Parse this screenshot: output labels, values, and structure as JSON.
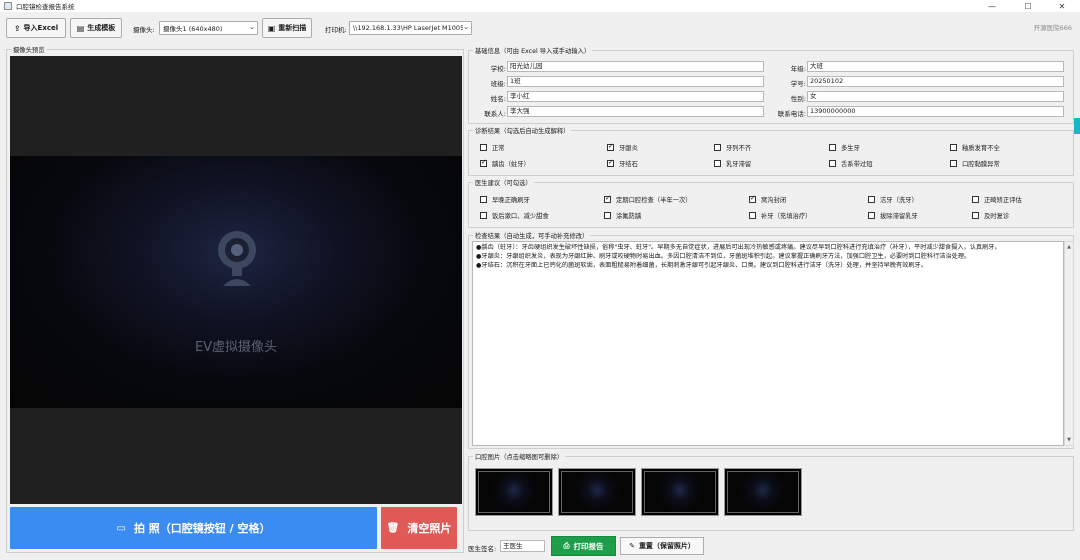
{
  "window": {
    "title": "口腔镜检查报告系统",
    "controls": {
      "minimize": "—",
      "maximize": "☐",
      "close": "✕"
    }
  },
  "toolbar": {
    "import_excel": "导入Excel",
    "generate_template": "生成模板",
    "camera_label": "摄像头:",
    "camera_value": "摄像头1 (640x480)",
    "rescan": "重新扫描",
    "printer_label": "打印机:",
    "printer_value": "\\\\192.168.1.33\\HP LaserJet M1005",
    "brand": "开源医院666"
  },
  "camera_preview": {
    "title": "摄像头预览",
    "device_label": "EV虚拟摄像头"
  },
  "capture": {
    "capture_button": "拍 照（口腔镜按钮 / 空格）",
    "clear_button": "清空照片"
  },
  "basic_info": {
    "title": "基础信息（可由 Excel 导入或手动输入）",
    "school_label": "学校:",
    "school": "阳光幼儿园",
    "grade_label": "年级:",
    "grade": "大班",
    "class_label": "班级:",
    "class": "1班",
    "student_id_label": "学号:",
    "student_id": "20250102",
    "name_label": "姓名:",
    "name": "李小红",
    "gender_label": "性别:",
    "gender": "女",
    "contact_label": "联系人:",
    "contact": "李大强",
    "phone_label": "联系电话:",
    "phone": "13900000000"
  },
  "diagnosis": {
    "title": "诊断结果（勾选后自动生成解释）",
    "items": [
      {
        "label": "正常",
        "checked": false
      },
      {
        "label": "牙龈炎",
        "checked": true
      },
      {
        "label": "牙列不齐",
        "checked": false
      },
      {
        "label": "多生牙",
        "checked": false
      },
      {
        "label": "釉质发育不全",
        "checked": false
      },
      {
        "label": "龋齿（蛀牙）",
        "checked": true
      },
      {
        "label": "牙结石",
        "checked": true
      },
      {
        "label": "乳牙滞留",
        "checked": false
      },
      {
        "label": "舌系带过短",
        "checked": false
      },
      {
        "label": "口腔黏膜异常",
        "checked": false
      }
    ]
  },
  "advice": {
    "title": "医生建议（可勾选）",
    "items": [
      {
        "label": "早晚正确刷牙",
        "checked": false
      },
      {
        "label": "定期口腔检查（半年一次）",
        "checked": true
      },
      {
        "label": "窝沟封闭",
        "checked": true
      },
      {
        "label": "洁牙（洗牙）",
        "checked": false
      },
      {
        "label": "正畸矫正评估",
        "checked": false
      },
      {
        "label": "饭后漱口、减少甜食",
        "checked": false
      },
      {
        "label": "涂氟防龋",
        "checked": false
      },
      {
        "label": "补牙（充填治疗）",
        "checked": false
      },
      {
        "label": "拔除滞留乳牙",
        "checked": false
      },
      {
        "label": "及时复诊",
        "checked": false
      }
    ]
  },
  "results": {
    "title": "检查结果（自动生成，可手动补充修改）",
    "lines": [
      "●龋齿（蛀牙）：牙齿硬组织发生破坏性缺损，俗称\"虫牙、蛀牙\"。早期多无自觉症状，进展后可出现冷热敏感或疼痛。建议尽早到口腔科进行充填治疗（补牙），平时减少甜食摄入，认真刷牙。",
      "●牙龈炎：牙龈组织发炎，表现为牙龈红肿、刷牙或咬硬物时易出血。多因口腔清洁不到位，牙菌斑堆积引起。建议掌握正确刷牙方法，加强口腔卫生，必要时到口腔科行洁治处理。",
      "●牙结石：沉积在牙面上已钙化的菌斑软垢，表面粗糙易附着细菌，长期刺激牙龈可引起牙龈炎、口臭。建议到口腔科进行洁牙（洗牙）处理，并坚持早晚有效刷牙。"
    ]
  },
  "photos": {
    "title": "口腔图片（点击缩略图可删除）",
    "count": 4
  },
  "footer": {
    "doctor_label": "医生签名:",
    "doctor_name": "王医生",
    "print_button": "打印报告",
    "reset_button": "重置（保留照片）"
  }
}
